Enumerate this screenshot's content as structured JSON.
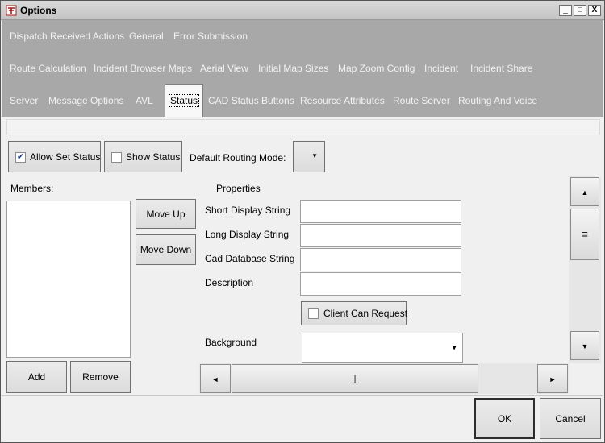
{
  "window": {
    "title": "Options",
    "icon": "app-logo-icon",
    "controls": [
      "_",
      "□",
      "X"
    ]
  },
  "tabs": {
    "row1": [
      "Dispatch Received Actions",
      "General",
      "Error Submission"
    ],
    "row2": [
      "Route Calculation",
      "Incident Browser Maps",
      "Aerial View",
      "Initial Map Sizes",
      "Map Zoom Config",
      "Incident",
      "Incident Share"
    ],
    "row3": [
      "Server",
      "Message Options",
      "AVL",
      "Status",
      "CAD Status Buttons",
      "Resource Attributes",
      "Route Server",
      "Routing And Voice"
    ],
    "active": "Status"
  },
  "status": {
    "allow_set_status": {
      "label": "Allow Set Status",
      "checked": true
    },
    "show_status": {
      "label": "Show Status",
      "checked": false
    },
    "default_routing_mode_label": "Default Routing Mode:",
    "default_routing_mode_value": "",
    "members_label": "Members:",
    "move_up": "Move Up",
    "move_down": "Move Down",
    "add": "Add",
    "remove": "Remove",
    "properties": {
      "heading": "Properties",
      "short_display_label": "Short Display String",
      "short_display_value": "",
      "long_display_label": "Long Display String",
      "long_display_value": "",
      "cad_db_label": "Cad Database String",
      "cad_db_value": "",
      "description_label": "Description",
      "description_value": "",
      "client_can_request": {
        "label": "Client Can Request",
        "checked": false
      },
      "background_label": "Background",
      "background_value": ""
    }
  },
  "scroll": {
    "up_arrow": "▲",
    "down_arrow": "▼",
    "left_arrow": "◄",
    "right_arrow": "►",
    "v_grip": "≡",
    "h_grip": "|||"
  },
  "footer": {
    "ok": "OK",
    "cancel": "Cancel"
  },
  "colors": {
    "tab_area": "#a8a8a8",
    "tab_text": "#f2f2f2",
    "check_mark": "#1c3f8a"
  }
}
